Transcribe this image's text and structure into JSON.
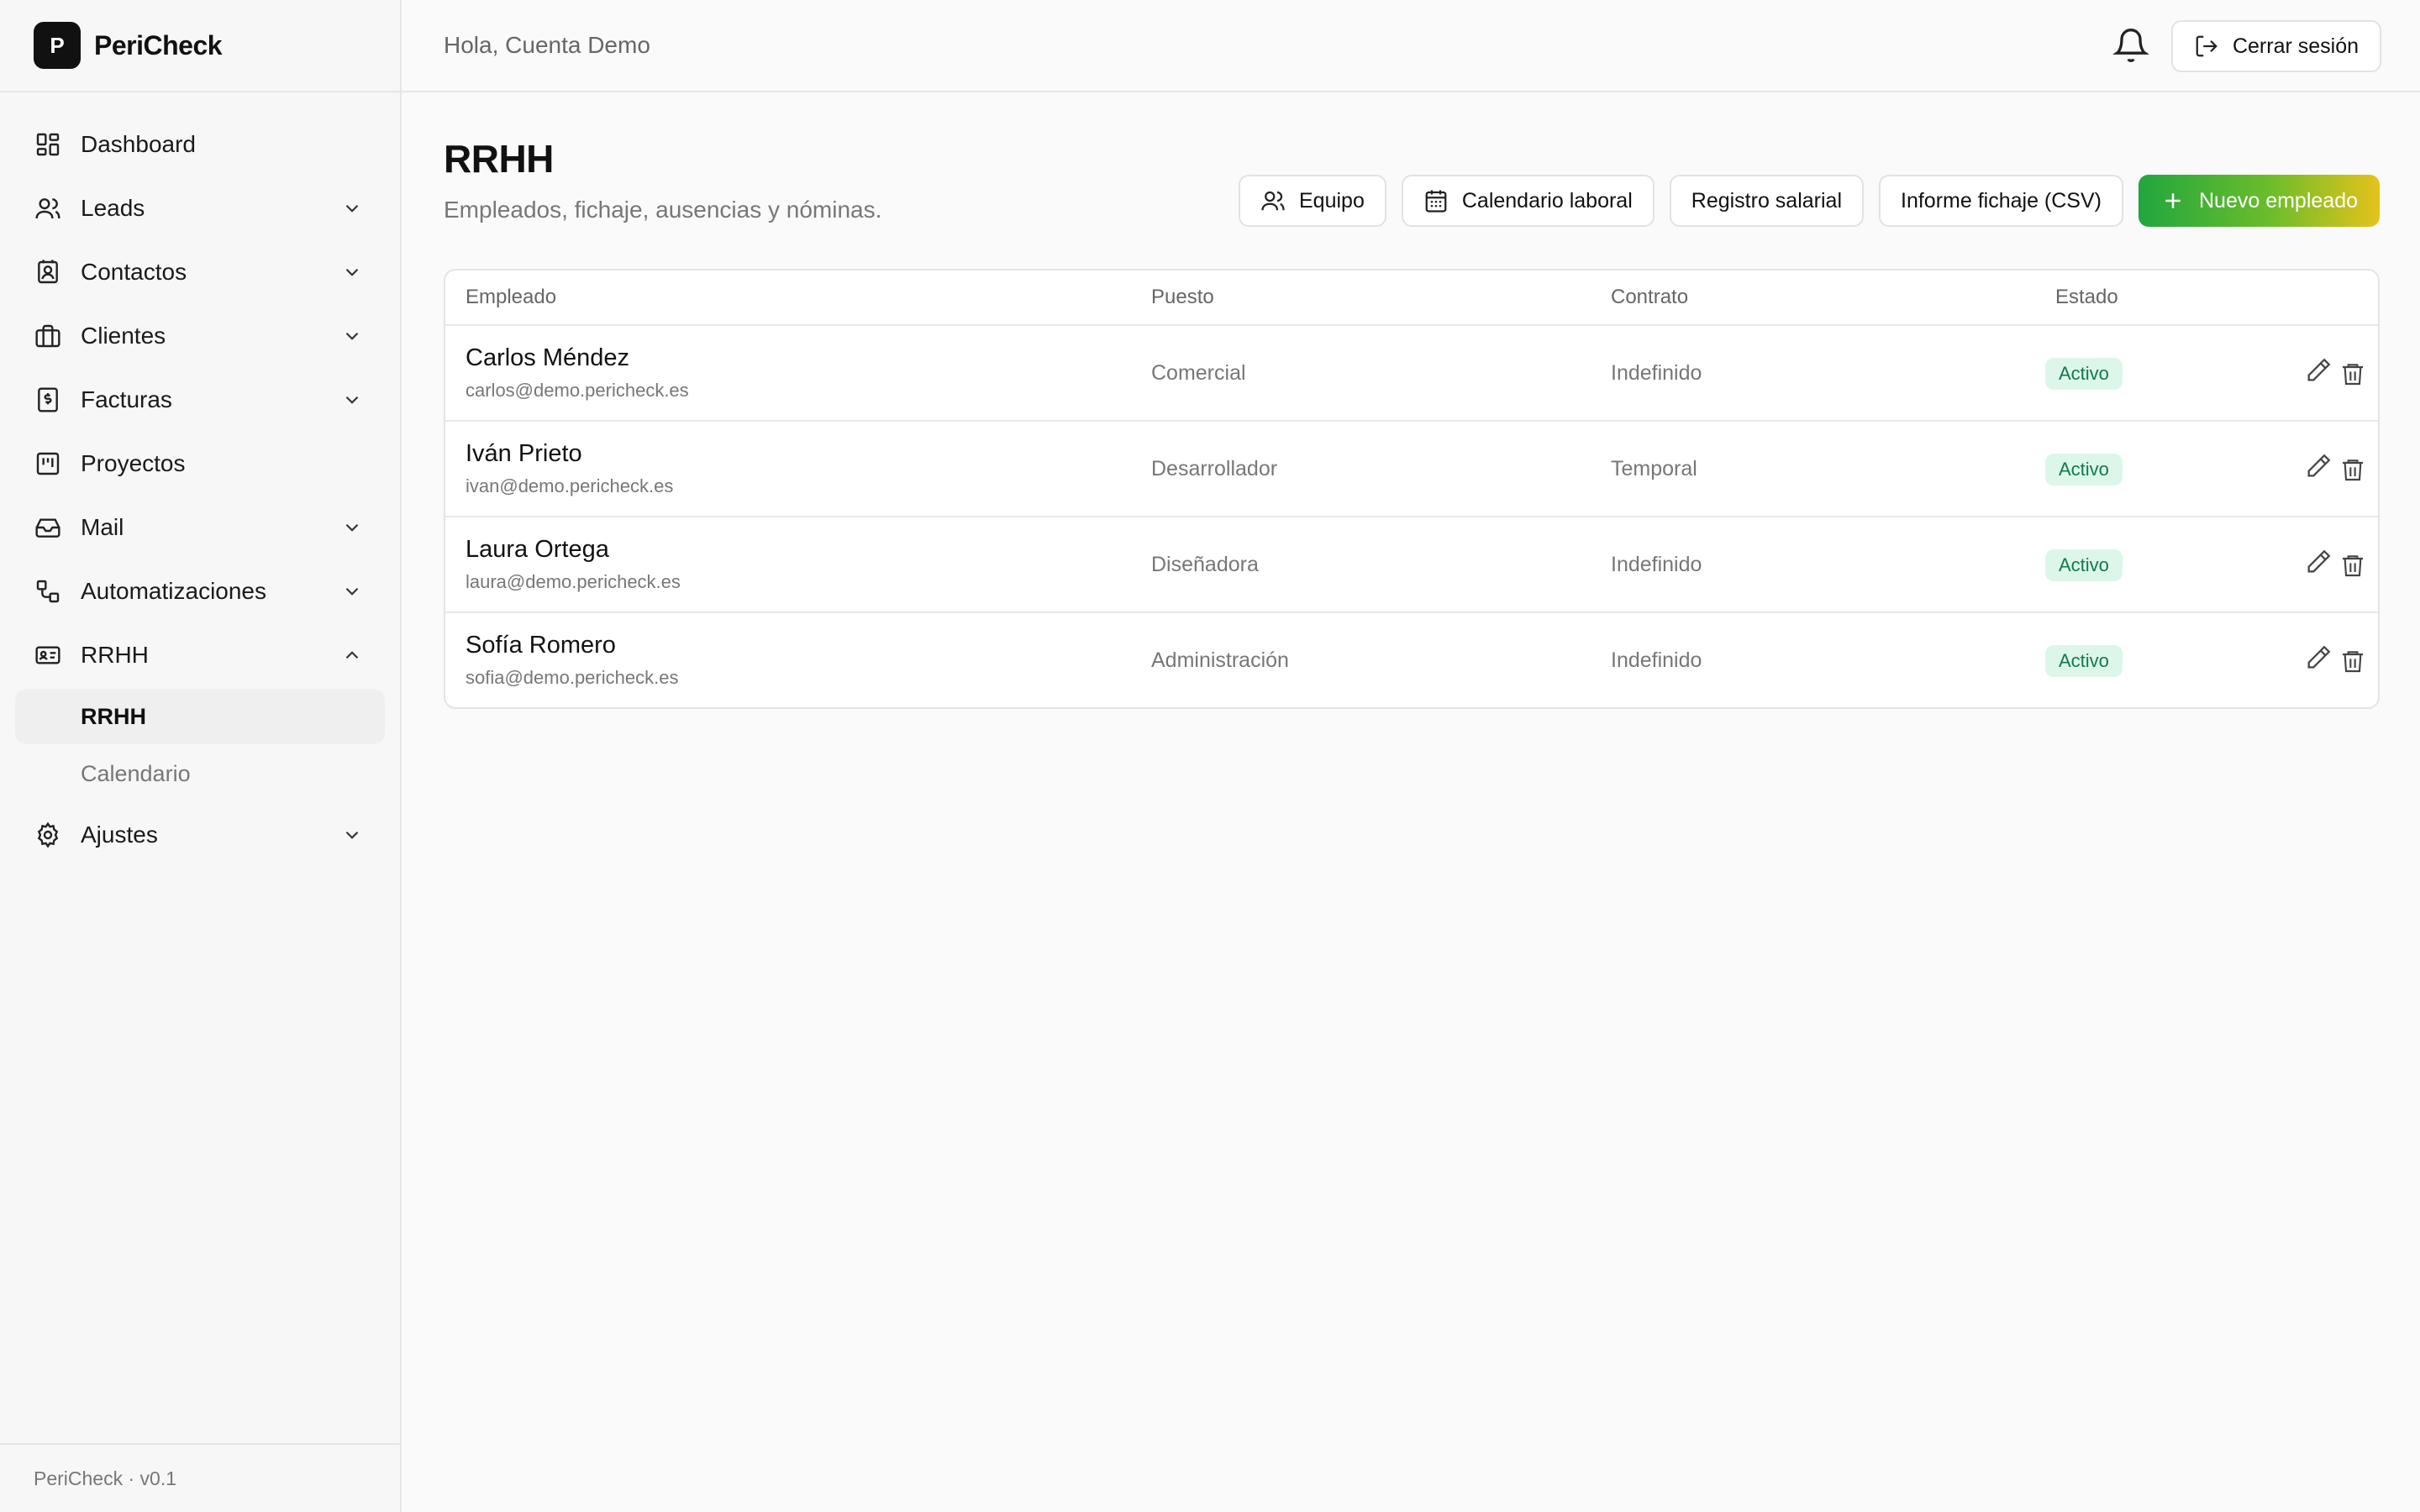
{
  "brand": {
    "logo_letter": "P",
    "name": "PeriCheck"
  },
  "sidebar": {
    "items": [
      {
        "label": "Dashboard",
        "icon": "dashboard-icon",
        "expandable": false
      },
      {
        "label": "Leads",
        "icon": "users-icon",
        "expandable": true
      },
      {
        "label": "Contactos",
        "icon": "contact-book-icon",
        "expandable": true
      },
      {
        "label": "Clientes",
        "icon": "briefcase-icon",
        "expandable": true
      },
      {
        "label": "Facturas",
        "icon": "invoice-icon",
        "expandable": true
      },
      {
        "label": "Proyectos",
        "icon": "kanban-icon",
        "expandable": false
      },
      {
        "label": "Mail",
        "icon": "inbox-icon",
        "expandable": true
      },
      {
        "label": "Automatizaciones",
        "icon": "workflow-icon",
        "expandable": true
      },
      {
        "label": "RRHH",
        "icon": "id-card-icon",
        "expandable": true,
        "expanded": true
      },
      {
        "label": "Ajustes",
        "icon": "gear-icon",
        "expandable": true
      }
    ],
    "rrhh_subitems": [
      {
        "label": "RRHH",
        "active": true
      },
      {
        "label": "Calendario",
        "active": false
      }
    ],
    "footer": "PeriCheck · v0.1"
  },
  "topbar": {
    "greeting": "Hola, Cuenta Demo",
    "logout_label": "Cerrar sesión"
  },
  "page": {
    "title": "RRHH",
    "subtitle": "Empleados, fichaje, ausencias y nóminas.",
    "actions": {
      "team": "Equipo",
      "work_calendar": "Calendario laboral",
      "salary_register": "Registro salarial",
      "clock_report": "Informe fichaje (CSV)",
      "new_employee": "Nuevo empleado"
    }
  },
  "table": {
    "columns": [
      "Empleado",
      "Puesto",
      "Contrato",
      "Estado"
    ],
    "rows": [
      {
        "name": "Carlos Méndez",
        "email": "carlos@demo.pericheck.es",
        "position": "Comercial",
        "contract": "Indefinido",
        "status": "Activo"
      },
      {
        "name": "Iván Prieto",
        "email": "ivan@demo.pericheck.es",
        "position": "Desarrollador",
        "contract": "Temporal",
        "status": "Activo"
      },
      {
        "name": "Laura Ortega",
        "email": "laura@demo.pericheck.es",
        "position": "Diseñadora",
        "contract": "Indefinido",
        "status": "Activo"
      },
      {
        "name": "Sofía Romero",
        "email": "sofia@demo.pericheck.es",
        "position": "Administración",
        "contract": "Indefinido",
        "status": "Activo"
      }
    ]
  },
  "colors": {
    "accent_start": "#21a63f",
    "accent_end": "#e6c21b",
    "badge_bg": "#dcf7ea",
    "badge_text": "#12794a"
  }
}
